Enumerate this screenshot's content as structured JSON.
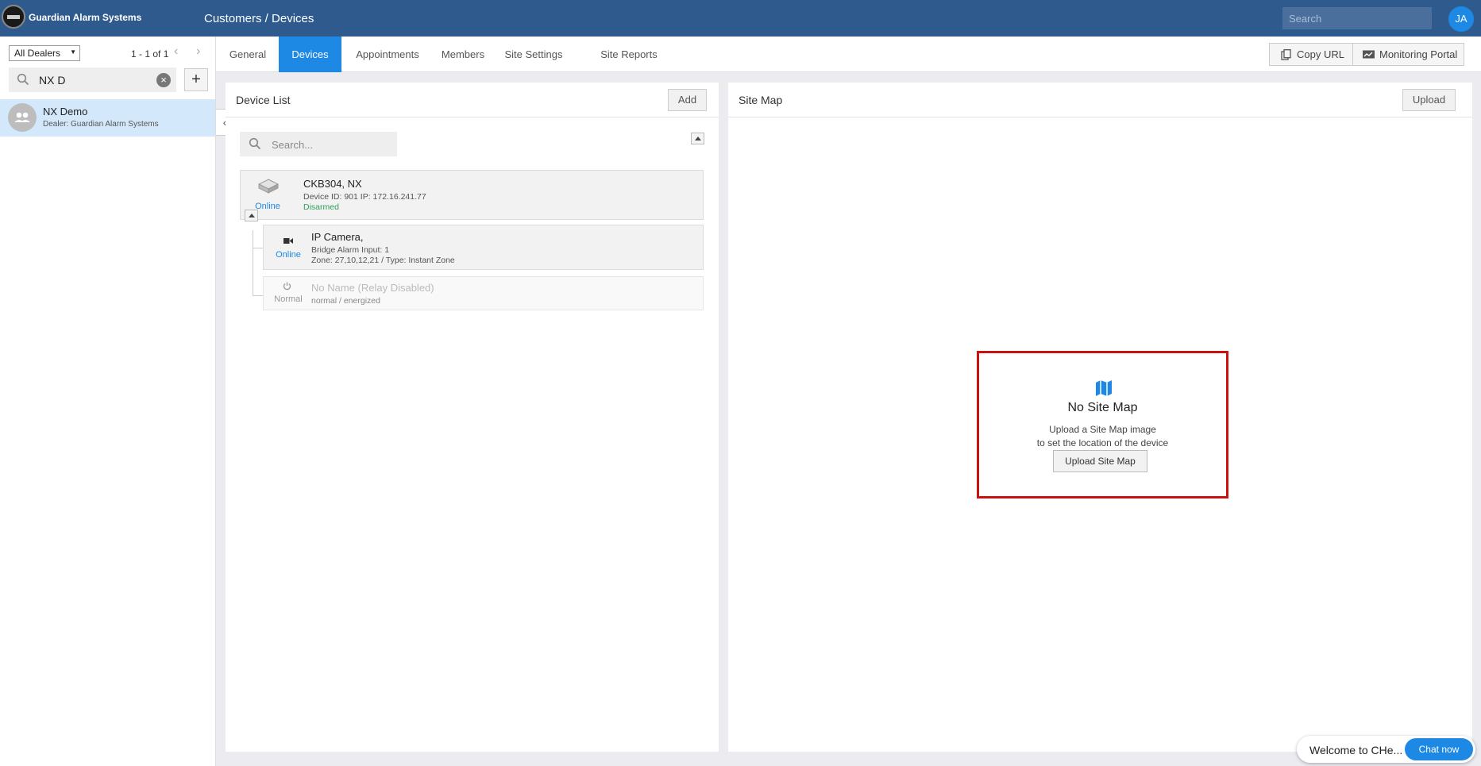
{
  "header": {
    "brand": "Guardian Alarm Systems",
    "title": "Customers / Devices",
    "search_placeholder": "Search",
    "avatar_initials": "JA"
  },
  "sidebar": {
    "dealer_filter": "All Dealers",
    "pager": "1 - 1 of 1",
    "search_value": "NX D",
    "customers": [
      {
        "name": "NX Demo",
        "dealer": "Dealer: Guardian Alarm Systems"
      }
    ]
  },
  "tabs": [
    {
      "label": "General"
    },
    {
      "label": "Devices",
      "active": true
    },
    {
      "label": "Appointments"
    },
    {
      "label": "Members"
    },
    {
      "label": "Site Settings"
    },
    {
      "label": "Site Reports"
    }
  ],
  "toolbar": {
    "copy_url": "Copy URL",
    "monitoring_portal": "Monitoring Portal"
  },
  "device_list": {
    "title": "Device List",
    "add_label": "Add",
    "search_placeholder": "Search...",
    "devices": [
      {
        "status": "Online",
        "name": "CKB304, NX",
        "line1": "Device ID: 901 IP: 172.16.241.77",
        "line2": "Disarmed"
      },
      {
        "status": "Online",
        "name": "IP Camera,",
        "line1": "Bridge Alarm Input: 1",
        "line2": "Zone: 27,10,12,21 / Type: Instant Zone"
      },
      {
        "status": "Normal",
        "name": "No Name (Relay Disabled)",
        "line1": "normal / energized"
      }
    ]
  },
  "site_map": {
    "title": "Site Map",
    "upload_label": "Upload",
    "empty_title": "No Site Map",
    "empty_line1": "Upload a Site Map image",
    "empty_line2": "to set the location of the device",
    "upload_site_map_label": "Upload Site Map"
  },
  "chat": {
    "welcome": "Welcome to CHe...",
    "button": "Chat now"
  },
  "colors": {
    "header_bg": "#2f5a8e",
    "accent": "#1e88e5",
    "online": "#1e88e5",
    "disarmed": "#2e9e5b",
    "highlight_border": "#cc1111"
  }
}
